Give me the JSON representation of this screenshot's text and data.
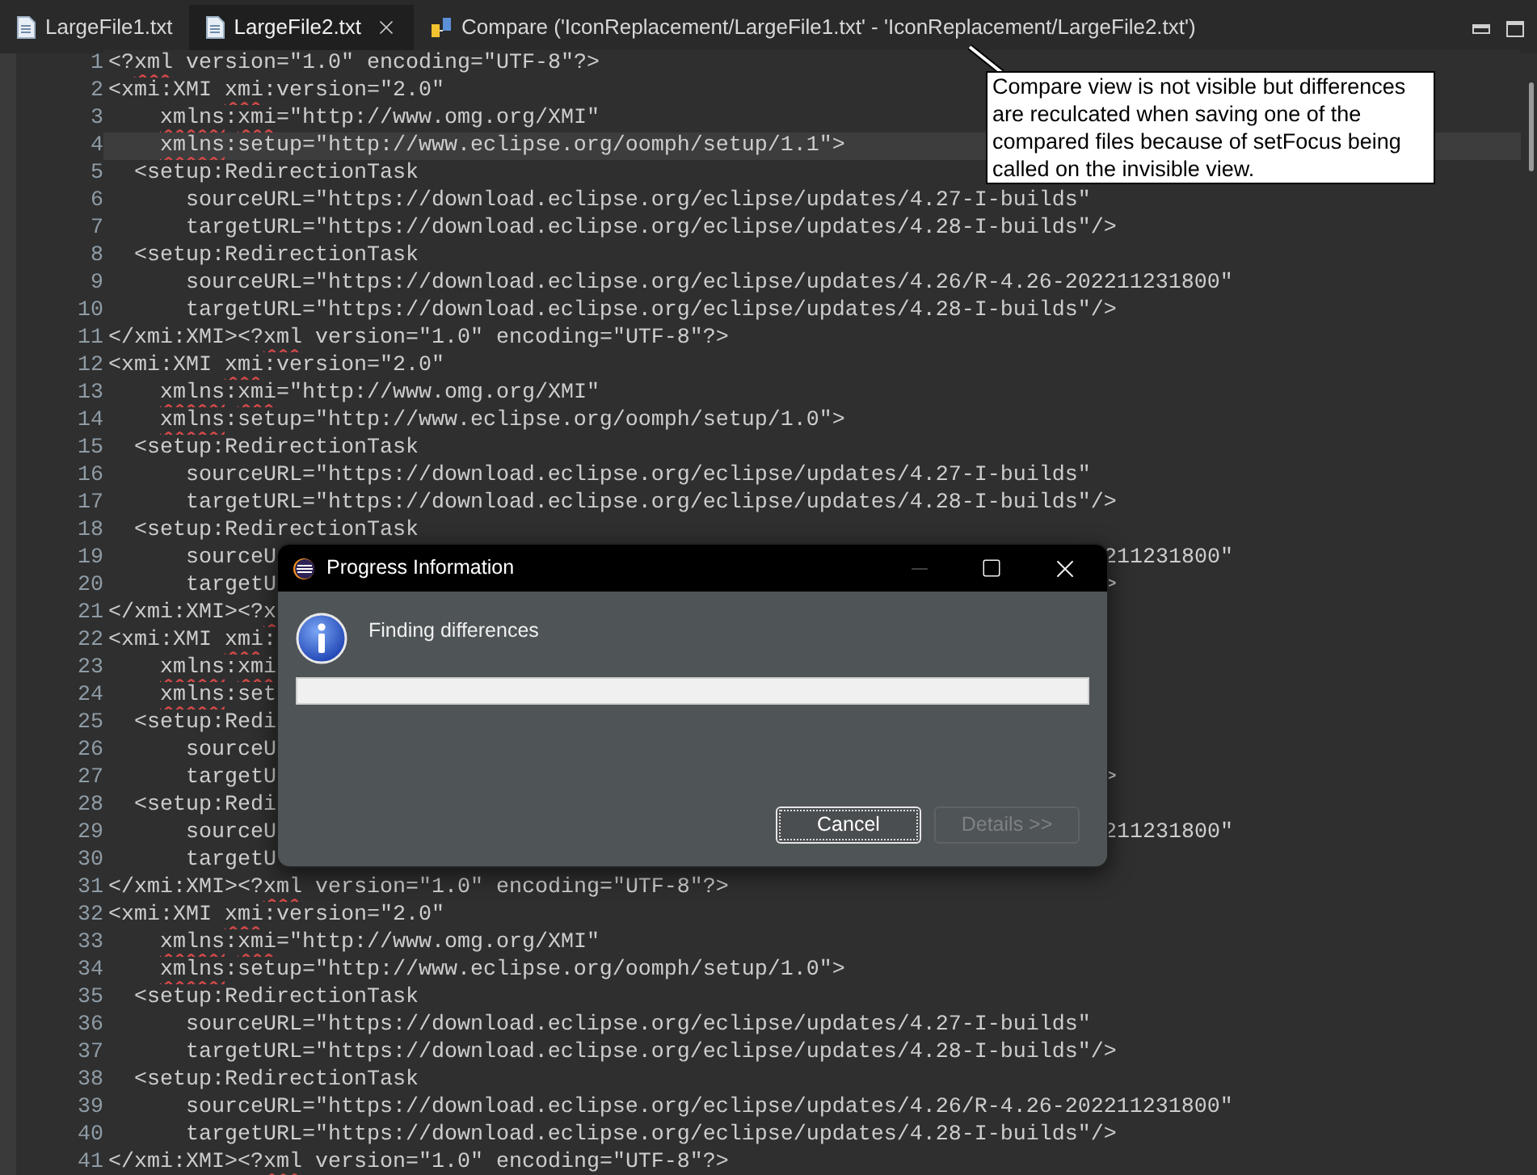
{
  "tabs": [
    {
      "label": "LargeFile1.txt",
      "kind": "file",
      "selected": false
    },
    {
      "label": "LargeFile2.txt",
      "kind": "file",
      "selected": true
    },
    {
      "label": "Compare ('IconReplacement/LargeFile1.txt' - 'IconReplacement/LargeFile2.txt')",
      "kind": "compare",
      "selected": false
    }
  ],
  "editor": {
    "lines": [
      {
        "number": "1",
        "kind": "root",
        "current": false,
        "segments": [
          {
            "text": "<?",
            "misspelled": false
          },
          {
            "text": "xml",
            "misspelled": true
          },
          {
            "text": " version=\"1.0\" encoding=\"UTF-8\"?>",
            "misspelled": false
          }
        ]
      },
      {
        "number": "2",
        "kind": "root",
        "current": false,
        "segments": [
          {
            "text": "<xmi:XMI ",
            "misspelled": false
          },
          {
            "text": "xmi",
            "misspelled": true
          },
          {
            "text": ":version=\"2.0\"",
            "misspelled": false
          }
        ]
      },
      {
        "number": "3",
        "kind": "attribute",
        "current": false,
        "segments": [
          {
            "text": "xmlns",
            "misspelled": true
          },
          {
            "text": ":",
            "misspelled": false
          },
          {
            "text": "xmi",
            "misspelled": true
          },
          {
            "text": "=\"http://www.omg.org/XMI\"",
            "misspelled": false
          }
        ]
      },
      {
        "number": "4",
        "kind": "attribute",
        "current": true,
        "segments": [
          {
            "text": "xmlns",
            "misspelled": true
          },
          {
            "text": ":setup=\"http://www.eclipse.org/oomph/setup/1.1\">",
            "misspelled": false
          }
        ]
      },
      {
        "number": "5",
        "kind": "child",
        "current": false,
        "segments": [
          {
            "text": "<setup:RedirectionTask",
            "misspelled": false
          }
        ]
      },
      {
        "number": "6",
        "kind": "child-attribute",
        "current": false,
        "segments": [
          {
            "text": "sourceURL=\"https://download.eclipse.org/eclipse/updates/4.27-I-builds\"",
            "misspelled": false
          }
        ]
      },
      {
        "number": "7",
        "kind": "child-attribute",
        "current": false,
        "segments": [
          {
            "text": "targetURL=\"https://download.eclipse.org/eclipse/updates/4.28-I-builds\"/>",
            "misspelled": false
          }
        ]
      },
      {
        "number": "8",
        "kind": "child",
        "current": false,
        "segments": [
          {
            "text": "<setup:RedirectionTask",
            "misspelled": false
          }
        ]
      },
      {
        "number": "9",
        "kind": "child-attribute",
        "current": false,
        "segments": [
          {
            "text": "sourceURL=\"https://download.eclipse.org/eclipse/updates/4.26/R-4.26-202211231800\"",
            "misspelled": false
          }
        ]
      },
      {
        "number": "10",
        "kind": "child-attribute",
        "current": false,
        "segments": [
          {
            "text": "targetURL=\"https://download.eclipse.org/eclipse/updates/4.28-I-builds\"/>",
            "misspelled": false
          }
        ]
      },
      {
        "number": "11",
        "kind": "root",
        "current": false,
        "segments": [
          {
            "text": "</xmi:XMI><?",
            "misspelled": false
          },
          {
            "text": "xml",
            "misspelled": true
          },
          {
            "text": " version=\"1.0\" encoding=\"UTF-8\"?>",
            "misspelled": false
          }
        ]
      },
      {
        "number": "12",
        "kind": "root",
        "current": false,
        "segments": [
          {
            "text": "<xmi:XMI ",
            "misspelled": false
          },
          {
            "text": "xmi",
            "misspelled": true
          },
          {
            "text": ":version=\"2.0\"",
            "misspelled": false
          }
        ]
      },
      {
        "number": "13",
        "kind": "attribute",
        "current": false,
        "segments": [
          {
            "text": "xmlns",
            "misspelled": true
          },
          {
            "text": ":",
            "misspelled": false
          },
          {
            "text": "xmi",
            "misspelled": true
          },
          {
            "text": "=\"http://www.omg.org/XMI\"",
            "misspelled": false
          }
        ]
      },
      {
        "number": "14",
        "kind": "attribute",
        "current": false,
        "segments": [
          {
            "text": "xmlns",
            "misspelled": true
          },
          {
            "text": ":setup=\"http://www.eclipse.org/oomph/setup/1.0\">",
            "misspelled": false
          }
        ]
      },
      {
        "number": "15",
        "kind": "child",
        "current": false,
        "segments": [
          {
            "text": "<setup:RedirectionTask",
            "misspelled": false
          }
        ]
      },
      {
        "number": "16",
        "kind": "child-attribute",
        "current": false,
        "segments": [
          {
            "text": "sourceURL=\"https://download.eclipse.org/eclipse/updates/4.27-I-builds\"",
            "misspelled": false
          }
        ]
      },
      {
        "number": "17",
        "kind": "child-attribute",
        "current": false,
        "segments": [
          {
            "text": "targetURL=\"https://download.eclipse.org/eclipse/updates/4.28-I-builds\"/>",
            "misspelled": false
          }
        ]
      },
      {
        "number": "18",
        "kind": "child",
        "current": false,
        "segments": [
          {
            "text": "<setup:RedirectionTask",
            "misspelled": false
          }
        ]
      },
      {
        "number": "19",
        "kind": "child-attribute",
        "current": false,
        "segments": [
          {
            "text": "sourceU",
            "misspelled": false
          }
        ],
        "right": "211231800\""
      },
      {
        "number": "20",
        "kind": "child-attribute",
        "current": false,
        "segments": [
          {
            "text": "targetU",
            "misspelled": false
          }
        ],
        "right": ">"
      },
      {
        "number": "21",
        "kind": "root",
        "current": false,
        "segments": [
          {
            "text": "</xmi:XMI><?",
            "misspelled": false
          },
          {
            "text": "x",
            "misspelled": true
          }
        ]
      },
      {
        "number": "22",
        "kind": "root",
        "current": false,
        "segments": [
          {
            "text": "<xmi:XMI ",
            "misspelled": false
          },
          {
            "text": "xmi",
            "misspelled": true
          },
          {
            "text": ":",
            "misspelled": false
          }
        ]
      },
      {
        "number": "23",
        "kind": "attribute",
        "current": false,
        "segments": [
          {
            "text": "xmlns",
            "misspelled": true
          },
          {
            "text": ":",
            "misspelled": false
          },
          {
            "text": "xmi",
            "misspelled": true
          }
        ]
      },
      {
        "number": "24",
        "kind": "attribute",
        "current": false,
        "segments": [
          {
            "text": "xmlns",
            "misspelled": true
          },
          {
            "text": ":set",
            "misspelled": false
          }
        ]
      },
      {
        "number": "25",
        "kind": "child",
        "current": false,
        "segments": [
          {
            "text": "<setup:Redi",
            "misspelled": false
          }
        ]
      },
      {
        "number": "26",
        "kind": "child-attribute",
        "current": false,
        "segments": [
          {
            "text": "sourceU",
            "misspelled": false
          }
        ]
      },
      {
        "number": "27",
        "kind": "child-attribute",
        "current": false,
        "segments": [
          {
            "text": "targetU",
            "misspelled": false
          }
        ],
        "right": ">"
      },
      {
        "number": "28",
        "kind": "child",
        "current": false,
        "segments": [
          {
            "text": "<setup:Redi",
            "misspelled": false
          }
        ]
      },
      {
        "number": "29",
        "kind": "child-attribute",
        "current": false,
        "segments": [
          {
            "text": "sourceU",
            "misspelled": false
          }
        ],
        "right": "211231800\""
      },
      {
        "number": "30",
        "kind": "child-attribute",
        "current": false,
        "segments": [
          {
            "text": "targetU",
            "misspelled": false
          }
        ]
      },
      {
        "number": "31",
        "kind": "root",
        "current": false,
        "segments": [
          {
            "text": "</xmi:XMI><?",
            "misspelled": false
          },
          {
            "text": "xml",
            "misspelled": true
          },
          {
            "text": " version=\"1.0\" encoding=\"UTF-8\"?>",
            "misspelled": false
          }
        ]
      },
      {
        "number": "32",
        "kind": "root",
        "current": false,
        "segments": [
          {
            "text": "<xmi:XMI ",
            "misspelled": false
          },
          {
            "text": "xmi",
            "misspelled": true
          },
          {
            "text": ":version=\"2.0\"",
            "misspelled": false
          }
        ]
      },
      {
        "number": "33",
        "kind": "attribute",
        "current": false,
        "segments": [
          {
            "text": "xmlns",
            "misspelled": true
          },
          {
            "text": ":",
            "misspelled": false
          },
          {
            "text": "xmi",
            "misspelled": true
          },
          {
            "text": "=\"http://www.omg.org/XMI\"",
            "misspelled": false
          }
        ]
      },
      {
        "number": "34",
        "kind": "attribute",
        "current": false,
        "segments": [
          {
            "text": "xmlns",
            "misspelled": true
          },
          {
            "text": ":setup=\"http://www.eclipse.org/oomph/setup/1.0\">",
            "misspelled": false
          }
        ]
      },
      {
        "number": "35",
        "kind": "child",
        "current": false,
        "segments": [
          {
            "text": "<setup:RedirectionTask",
            "misspelled": false
          }
        ]
      },
      {
        "number": "36",
        "kind": "child-attribute",
        "current": false,
        "segments": [
          {
            "text": "sourceURL=\"https://download.eclipse.org/eclipse/updates/4.27-I-builds\"",
            "misspelled": false
          }
        ]
      },
      {
        "number": "37",
        "kind": "child-attribute",
        "current": false,
        "segments": [
          {
            "text": "targetURL=\"https://download.eclipse.org/eclipse/updates/4.28-I-builds\"/>",
            "misspelled": false
          }
        ]
      },
      {
        "number": "38",
        "kind": "child",
        "current": false,
        "segments": [
          {
            "text": "<setup:RedirectionTask",
            "misspelled": false
          }
        ]
      },
      {
        "number": "39",
        "kind": "child-attribute",
        "current": false,
        "segments": [
          {
            "text": "sourceURL=\"https://download.eclipse.org/eclipse/updates/4.26/R-4.26-202211231800\"",
            "misspelled": false
          }
        ]
      },
      {
        "number": "40",
        "kind": "child-attribute",
        "current": false,
        "segments": [
          {
            "text": "targetURL=\"https://download.eclipse.org/eclipse/updates/4.28-I-builds\"/>",
            "misspelled": false
          }
        ]
      },
      {
        "number": "41",
        "kind": "root",
        "current": false,
        "segments": [
          {
            "text": "</xmi:XMI><?",
            "misspelled": false
          },
          {
            "text": "xml",
            "misspelled": true
          },
          {
            "text": " version=\"1.0\" encoding=\"UTF-8\"?>",
            "misspelled": false
          }
        ]
      }
    ]
  },
  "annotation": {
    "text": "Compare view is not visible but differences are reculcated when saving one of the compared files because of setFocus being called on the invisible view."
  },
  "dialog": {
    "title": "Progress Information",
    "controls": [
      {
        "kind": "minimize",
        "disabled": true
      },
      {
        "kind": "maximize",
        "disabled": false
      },
      {
        "kind": "close",
        "disabled": false
      }
    ],
    "message": "Finding differences",
    "progress": {
      "level": 0
    },
    "buttons": [
      {
        "label": "Cancel",
        "focused": true,
        "disabled": false
      },
      {
        "label": "Details >>",
        "focused": false,
        "disabled": true
      }
    ]
  }
}
